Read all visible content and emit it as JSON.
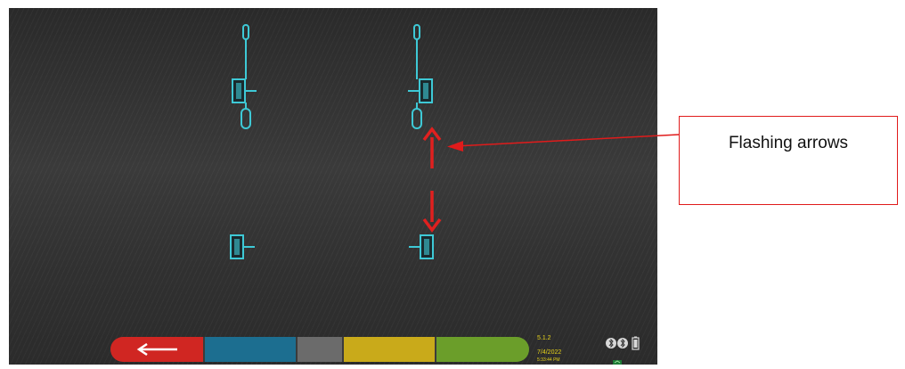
{
  "annotation": {
    "text": "Flashing arrows"
  },
  "toolbar": {
    "colors": {
      "back": "#d02622",
      "segment2": "#1c6e90",
      "segment3": "#6b6b6b",
      "segment4": "#c9aa1a",
      "segment5": "#6b9e2a"
    },
    "icons": {
      "back": "left-arrow-icon"
    }
  },
  "status": {
    "version": "5.1.2",
    "date": "7/4/2022",
    "time": "5:33:44 PM",
    "icons": [
      "bluetooth-icon",
      "bluetooth-icon",
      "battery-icon",
      "network-icon"
    ]
  },
  "sensors": {
    "color": "#3ec9d6",
    "items": [
      {
        "name": "front-left-sensor",
        "with_rods": true
      },
      {
        "name": "front-right-sensor",
        "with_rods": true
      },
      {
        "name": "rear-left-sensor",
        "with_rods": false
      },
      {
        "name": "rear-right-sensor",
        "with_rods": false
      }
    ]
  },
  "arrows": {
    "color": "#e0201f",
    "icons": [
      "up-arrow-icon",
      "down-arrow-icon"
    ]
  }
}
